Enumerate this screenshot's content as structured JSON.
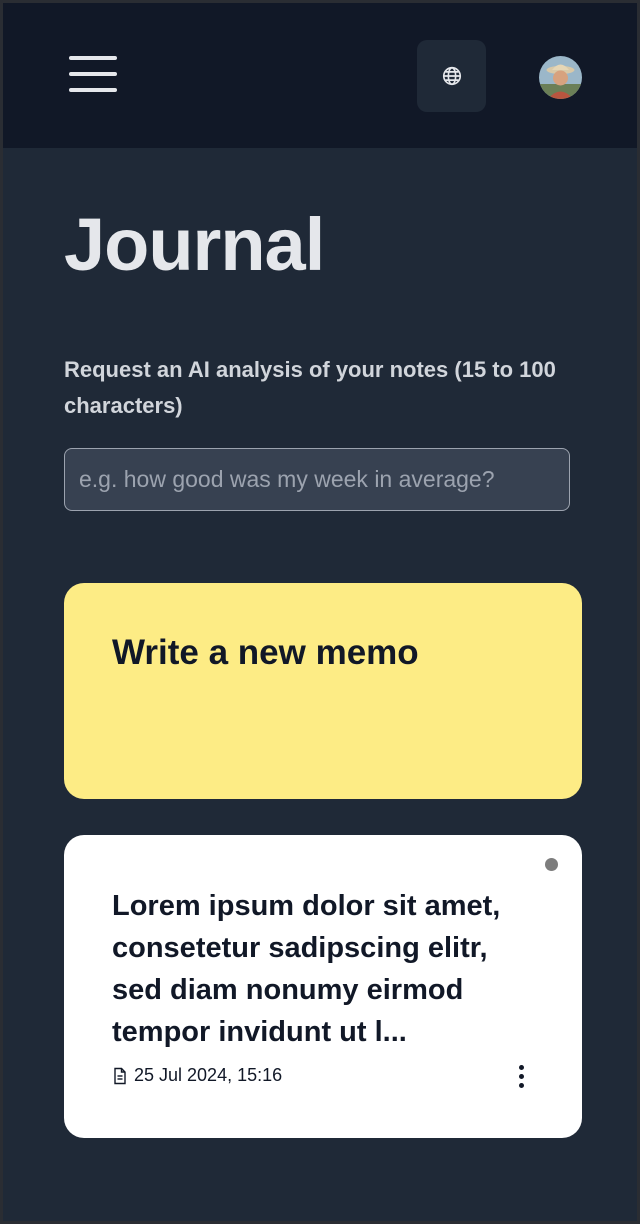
{
  "header": {
    "menu_icon": "hamburger-menu-icon",
    "language_icon": "globe-icon",
    "avatar": "user-avatar"
  },
  "main": {
    "title": "Journal",
    "ai_prompt_label": "Request an AI analysis of your notes (15 to 100 characters)",
    "ai_input_placeholder": "e.g. how good was my week in average?",
    "ai_input_value": ""
  },
  "new_memo": {
    "label": "Write a new memo",
    "color": "#fdec85"
  },
  "memos": [
    {
      "preview": "Lorem ipsum dolor sit amet, consetetur sadipscing elitr, sed diam nonumy eirmod tempor invidunt ut l...",
      "date": "25 Jul 2024, 15:16",
      "date_icon": "document-icon",
      "menu_icon": "more-vertical-icon",
      "status_dot_color": "#7d7d7d"
    }
  ],
  "colors": {
    "background": "#1f2937",
    "topbar": "#111827",
    "card": "#ffffff"
  }
}
